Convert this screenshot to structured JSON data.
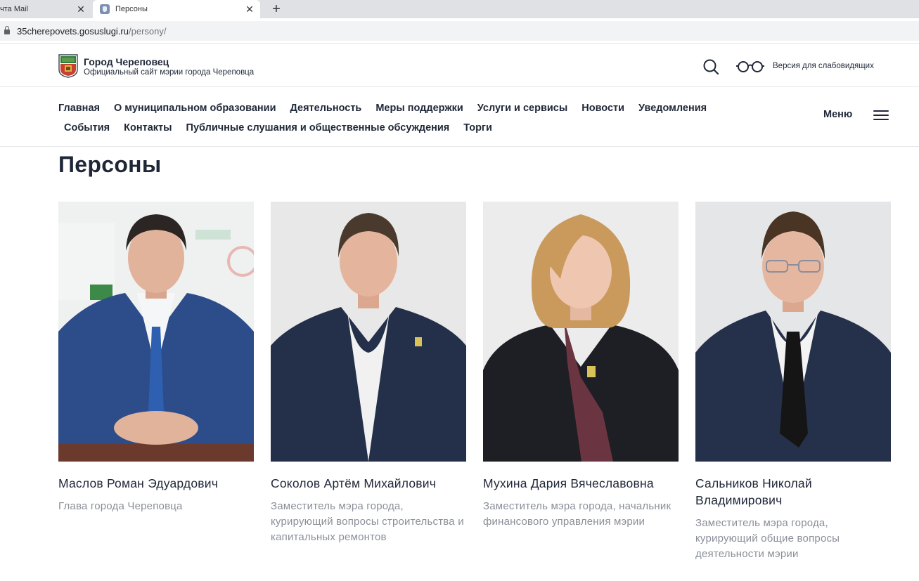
{
  "browser": {
    "tabs": [
      {
        "title": "чта Mail",
        "close": "✕"
      },
      {
        "title": "Персоны",
        "close": "✕"
      }
    ],
    "new_tab": "+",
    "url_host": "35cherepovets.gosuslugi.ru",
    "url_path": "/persony/"
  },
  "header": {
    "title": "Город Череповец",
    "subtitle": "Официальный сайт мэрии города Череповца",
    "accessibility_label": "Версия для слабовидящих"
  },
  "nav": {
    "row1": [
      "Главная",
      "О муниципальном образовании",
      "Деятельность",
      "Меры поддержки",
      "Услуги и сервисы",
      "Новости",
      "Уведомления"
    ],
    "row2": [
      "События",
      "Контакты",
      "Публичные слушания и общественные обсуждения",
      "Торги"
    ],
    "menu_label": "Меню"
  },
  "page": {
    "title": "Персоны"
  },
  "persons": [
    {
      "name": "Маслов Роман Эдуардович",
      "role": "Глава города Череповца"
    },
    {
      "name": "Соколов Артём Михайлович",
      "role": "Заместитель мэра города, курирующий вопросы строительства и капитальных ремонтов"
    },
    {
      "name": "Мухина Дария Вячеславовна",
      "role": "Заместитель мэра города, начальник финансового управления мэрии"
    },
    {
      "name": "Сальников Николай Владимирович",
      "role": "Заместитель мэра города, курирующий общие вопросы деятельности мэрии"
    }
  ]
}
